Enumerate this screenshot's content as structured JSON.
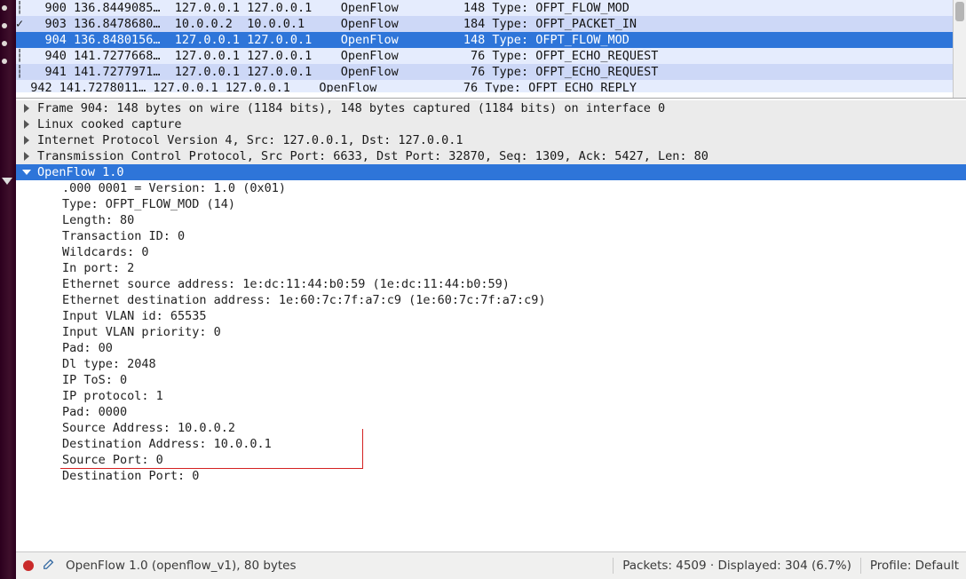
{
  "packets": [
    {
      "no": "900",
      "time": "136.8449085…",
      "src": "127.0.0.1",
      "dst": "127.0.0.1",
      "proto": "OpenFlow",
      "len": "148",
      "info": "Type: OFPT_FLOW_MOD",
      "style": "even",
      "mark": "┆"
    },
    {
      "no": "903",
      "time": "136.8478680…",
      "src": "10.0.0.2",
      "dst": "10.0.0.1",
      "proto": "OpenFlow",
      "len": "184",
      "info": "Type: OFPT_PACKET_IN",
      "style": "odd",
      "mark": "✓"
    },
    {
      "no": "904",
      "time": "136.8480156…",
      "src": "127.0.0.1",
      "dst": "127.0.0.1",
      "proto": "OpenFlow",
      "len": "148",
      "info": "Type: OFPT_FLOW_MOD",
      "style": "selected",
      "mark": ""
    },
    {
      "no": "940",
      "time": "141.7277668…",
      "src": "127.0.0.1",
      "dst": "127.0.0.1",
      "proto": "OpenFlow",
      "len": " 76",
      "info": "Type: OFPT_ECHO_REQUEST",
      "style": "even",
      "mark": "┆"
    },
    {
      "no": "941",
      "time": "141.7277971…",
      "src": "127.0.0.1",
      "dst": "127.0.0.1",
      "proto": "OpenFlow",
      "len": " 76",
      "info": "Type: OFPT_ECHO_REQUEST",
      "style": "odd",
      "mark": "┆"
    }
  ],
  "packet_partial": "  942 141.7278011… 127.0.0.1 127.0.0.1    OpenFlow            76 Type: OFPT_ECHO_REPLY",
  "tree": {
    "frame": "Frame 904: 148 bytes on wire (1184 bits), 148 bytes captured (1184 bits) on interface 0",
    "linux": "Linux cooked capture",
    "ip": "Internet Protocol Version 4, Src: 127.0.0.1, Dst: 127.0.0.1",
    "tcp": "Transmission Control Protocol, Src Port: 6633, Dst Port: 32870, Seq: 1309, Ack: 5427, Len: 80",
    "of": "OpenFlow 1.0",
    "of_items": [
      ".000 0001 = Version: 1.0 (0x01)",
      "Type: OFPT_FLOW_MOD (14)",
      "Length: 80",
      "Transaction ID: 0",
      "Wildcards: 0",
      "In port: 2",
      "Ethernet source address: 1e:dc:11:44:b0:59 (1e:dc:11:44:b0:59)",
      "Ethernet destination address: 1e:60:7c:7f:a7:c9 (1e:60:7c:7f:a7:c9)",
      "Input VLAN id: 65535",
      "Input VLAN priority: 0",
      "Pad: 00",
      "Dl type: 2048",
      "IP ToS: 0",
      "IP protocol: 1",
      "Pad: 0000",
      "Source Address: 10.0.0.2",
      "Destination Address: 10.0.0.1",
      "Source Port: 0",
      "Destination Port: 0"
    ]
  },
  "statusbar": {
    "proto": "OpenFlow 1.0 (openflow_v1), 80 bytes",
    "stats": "Packets: 4509 · Displayed: 304 (6.7%)",
    "profile": "Profile: Default"
  }
}
